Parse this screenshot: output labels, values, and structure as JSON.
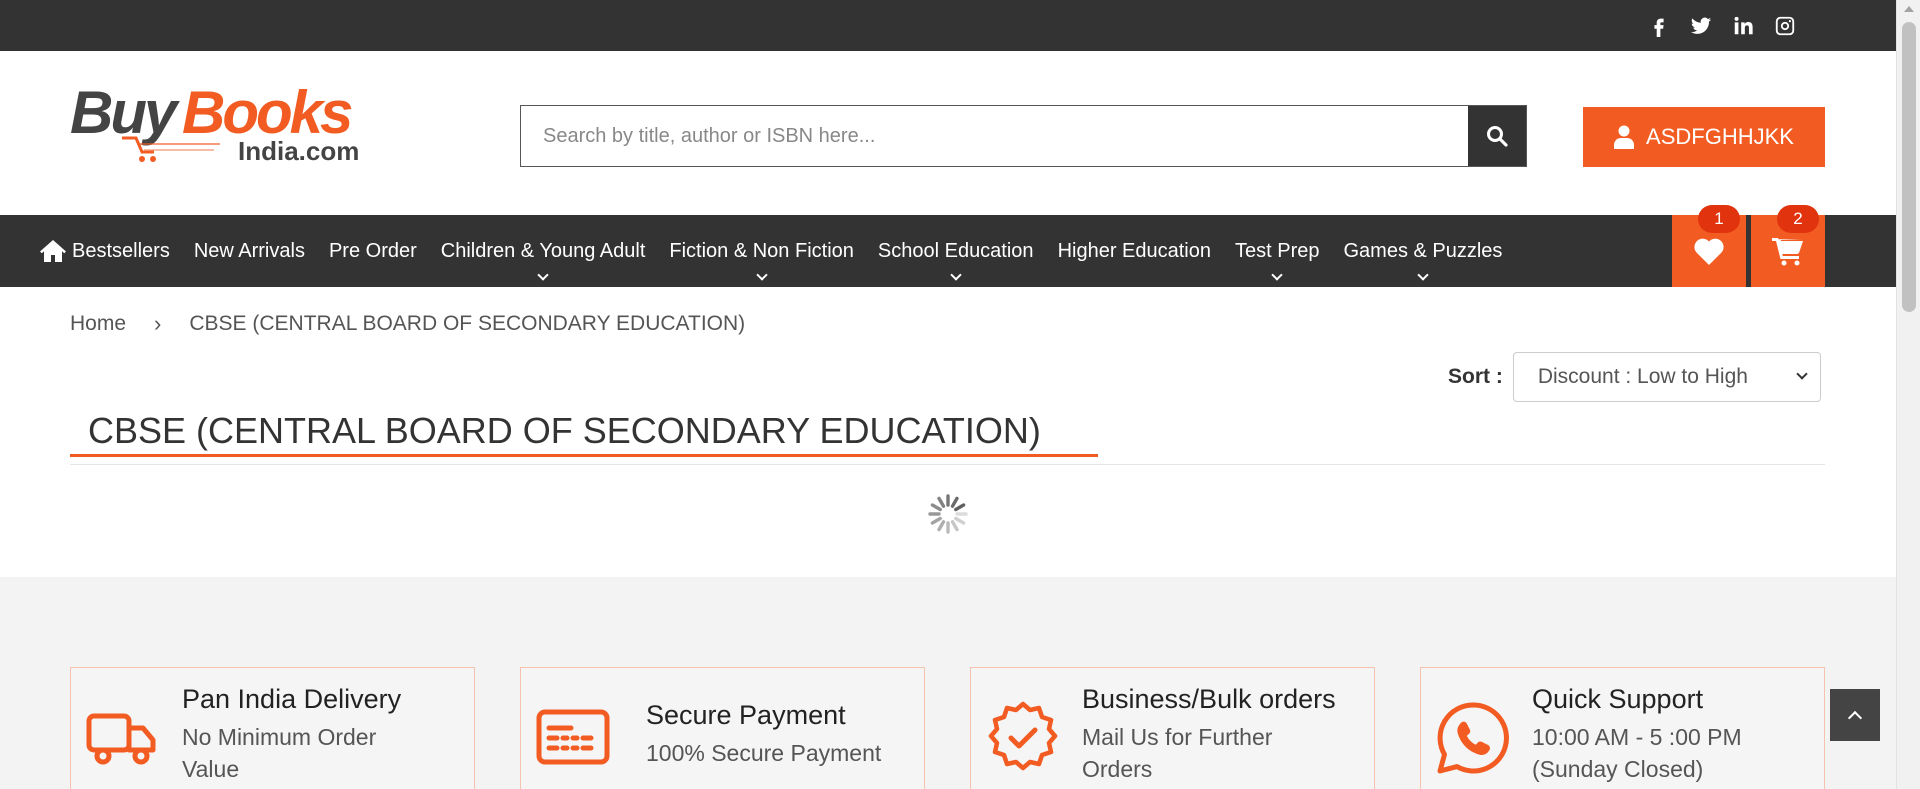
{
  "social": {
    "icons": [
      "facebook-icon",
      "twitter-icon",
      "linkedin-icon",
      "instagram-icon"
    ]
  },
  "logo": {
    "buy": "Buy",
    "books": "Books",
    "domain": "India.com"
  },
  "search": {
    "placeholder": "Search by title, author or ISBN here..."
  },
  "user": {
    "label": "ASDFGHHJKK"
  },
  "nav": {
    "items": [
      {
        "label": "Bestsellers",
        "dropdown": false
      },
      {
        "label": "New Arrivals",
        "dropdown": false
      },
      {
        "label": "Pre Order",
        "dropdown": false
      },
      {
        "label": "Children & Young Adult",
        "dropdown": true
      },
      {
        "label": "Fiction & Non Fiction",
        "dropdown": true
      },
      {
        "label": "School Education",
        "dropdown": true
      },
      {
        "label": "Higher Education",
        "dropdown": false
      },
      {
        "label": "Test Prep",
        "dropdown": true
      },
      {
        "label": "Games & Puzzles",
        "dropdown": true
      }
    ],
    "wishlist_count": "1",
    "cart_count": "2"
  },
  "breadcrumb": {
    "home": "Home",
    "separator": "›",
    "current": "CBSE (CENTRAL BOARD OF SECONDARY EDUCATION)"
  },
  "sort": {
    "label": "Sort :",
    "selected": "Discount : Low to High"
  },
  "page": {
    "title": "CBSE (CENTRAL BOARD OF SECONDARY EDUCATION)"
  },
  "features": [
    {
      "title": "Pan India Delivery",
      "line1": "No Minimum Order",
      "line2": "Value",
      "icon": "truck-icon"
    },
    {
      "title": "Secure Payment",
      "line1": "100% Secure Payment",
      "line2": "",
      "icon": "credit-card-icon"
    },
    {
      "title": "Business/Bulk orders",
      "line1": "Mail Us for Further",
      "line2": "Orders",
      "icon": "badge-check-icon"
    },
    {
      "title": "Quick Support",
      "line1": "10:00 AM - 5 :00 PM",
      "line2": "(Sunday Closed)",
      "icon": "whatsapp-icon"
    }
  ],
  "colors": {
    "accent": "#f25c22",
    "dark": "#333333",
    "badge": "#e0330e"
  }
}
